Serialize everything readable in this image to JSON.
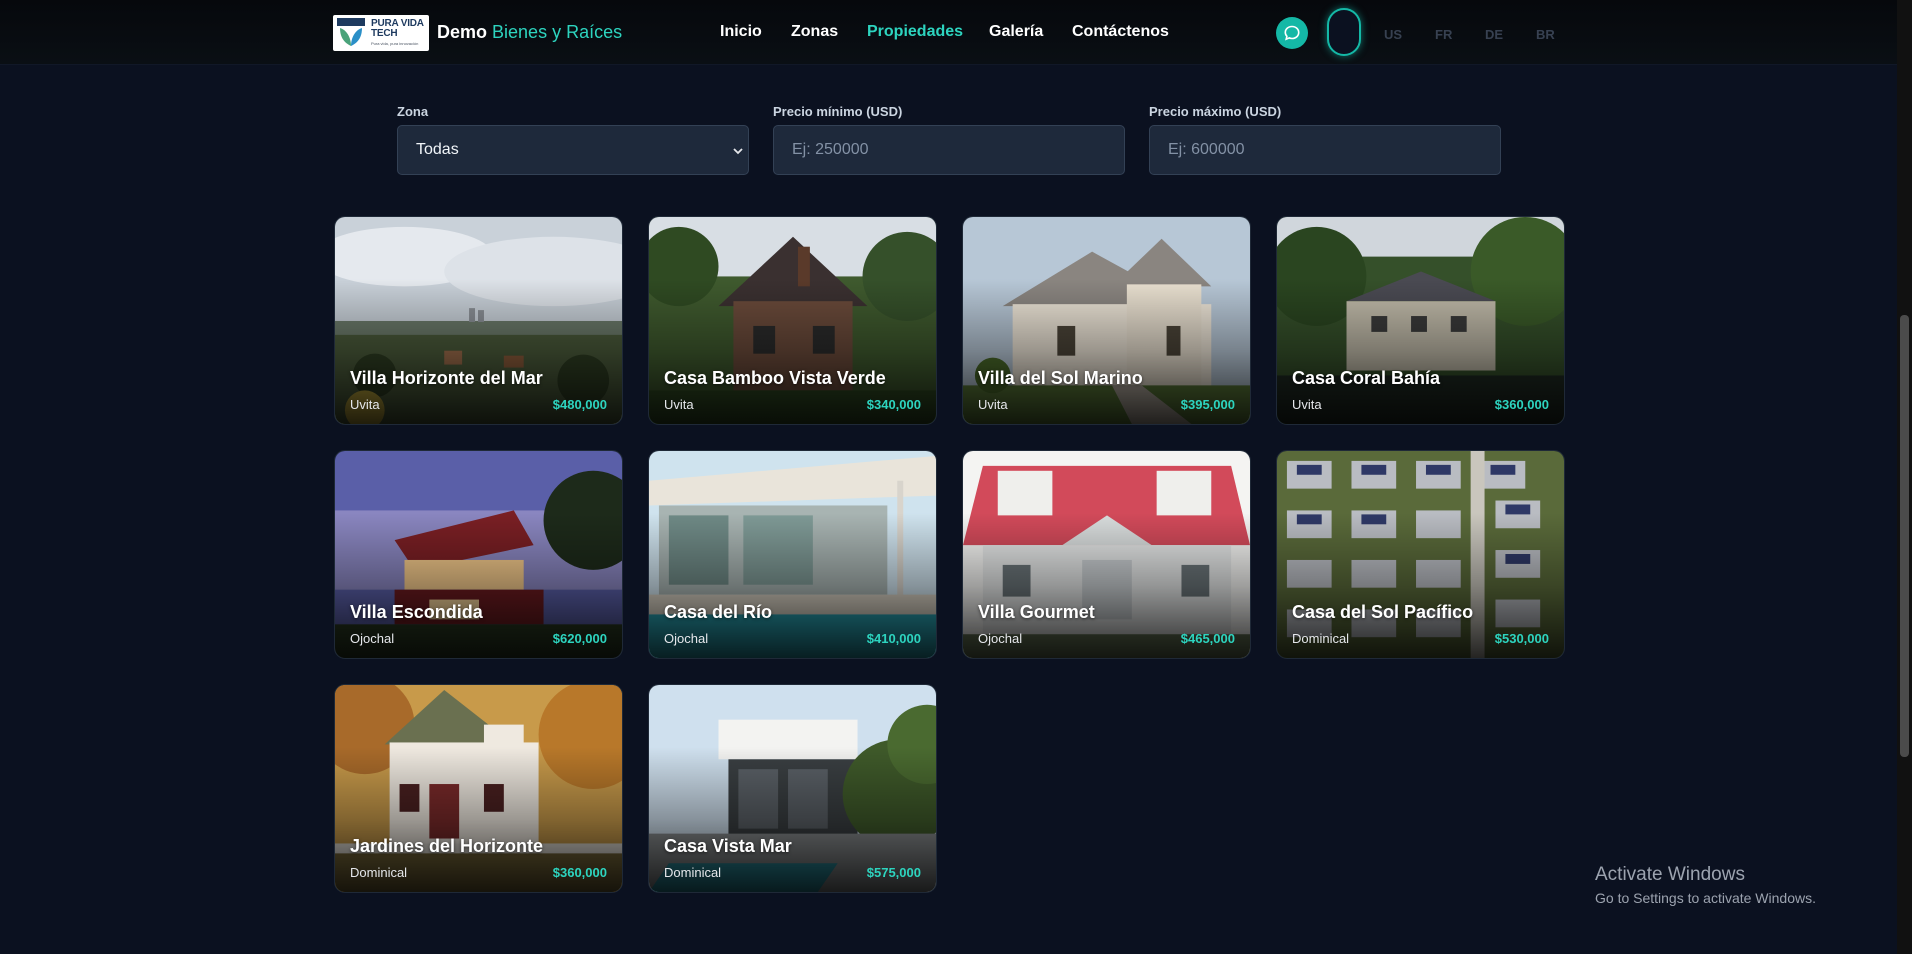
{
  "header": {
    "logo": {
      "text_line1": "PURA VIDA",
      "text_line2": "TECH",
      "tagline": "Pura vida, pura innovación"
    },
    "brand": {
      "prefix": "Demo",
      "accent": "Bienes y Raíces"
    },
    "nav": [
      {
        "label": "Inicio",
        "active": false
      },
      {
        "label": "Zonas",
        "active": false
      },
      {
        "label": "Propiedades",
        "active": true
      },
      {
        "label": "Galería",
        "active": false
      },
      {
        "label": "Contáctenos",
        "active": false
      }
    ],
    "languages": [
      "US",
      "FR",
      "DE",
      "BR"
    ]
  },
  "filters": {
    "zone": {
      "label": "Zona",
      "value": "Todas"
    },
    "min_price": {
      "label": "Precio mínimo (USD)",
      "placeholder": "Ej: 250000"
    },
    "max_price": {
      "label": "Precio máximo (USD)",
      "placeholder": "Ej: 600000"
    }
  },
  "properties": [
    {
      "title": "Villa Horizonte del Mar",
      "zone": "Uvita",
      "price": "$480,000"
    },
    {
      "title": "Casa Bamboo Vista Verde",
      "zone": "Uvita",
      "price": "$340,000"
    },
    {
      "title": "Villa del Sol Marino",
      "zone": "Uvita",
      "price": "$395,000"
    },
    {
      "title": "Casa Coral Bahía",
      "zone": "Uvita",
      "price": "$360,000"
    },
    {
      "title": "Villa Escondida",
      "zone": "Ojochal",
      "price": "$620,000"
    },
    {
      "title": "Casa del Río",
      "zone": "Ojochal",
      "price": "$410,000"
    },
    {
      "title": "Villa Gourmet",
      "zone": "Ojochal",
      "price": "$465,000"
    },
    {
      "title": "Casa del Sol Pacífico",
      "zone": "Dominical",
      "price": "$530,000"
    },
    {
      "title": "Jardines del Horizonte",
      "zone": "Dominical",
      "price": "$360,000"
    },
    {
      "title": "Casa Vista Mar",
      "zone": "Dominical",
      "price": "$575,000"
    }
  ],
  "watermark": {
    "title": "Activate Windows",
    "subtitle": "Go to Settings to activate Windows."
  },
  "icons": {
    "chat": "chat-bubble-icon",
    "zone_select": "chevron-down-icon"
  },
  "colors": {
    "accent": "#2dd4bf",
    "background": "#0b1120",
    "input_bg": "#1e293b"
  }
}
